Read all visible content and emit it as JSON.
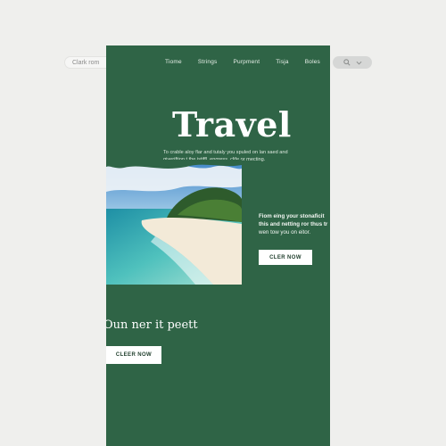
{
  "search": {
    "placeholder_text": "Clark rom"
  },
  "header": {
    "nav": [
      "Tiome",
      "Strings",
      "Purpment",
      "Tisja",
      "Boles"
    ]
  },
  "hero": {
    "title": "Travel",
    "subtitle": "To crable aloy flar and tutaly you spuled on lan saed and giveriftion t the istiffl, engress, clife or mecting."
  },
  "feature": {
    "text_lines": [
      "Fiom eing your stonaficit",
      "this and netting ror thus tr",
      "wen tow you on eitor."
    ],
    "cta_label": "CLER NOW"
  },
  "section": {
    "headline": "Oun ner it peett",
    "cta_label": "CLEER NOW"
  },
  "colors": {
    "page_bg": "#efefed",
    "panel_green": "#2f6446",
    "button_bg": "#ffffff"
  },
  "icons": {
    "search": "search-icon",
    "dropdown": "chevron-down-icon"
  }
}
